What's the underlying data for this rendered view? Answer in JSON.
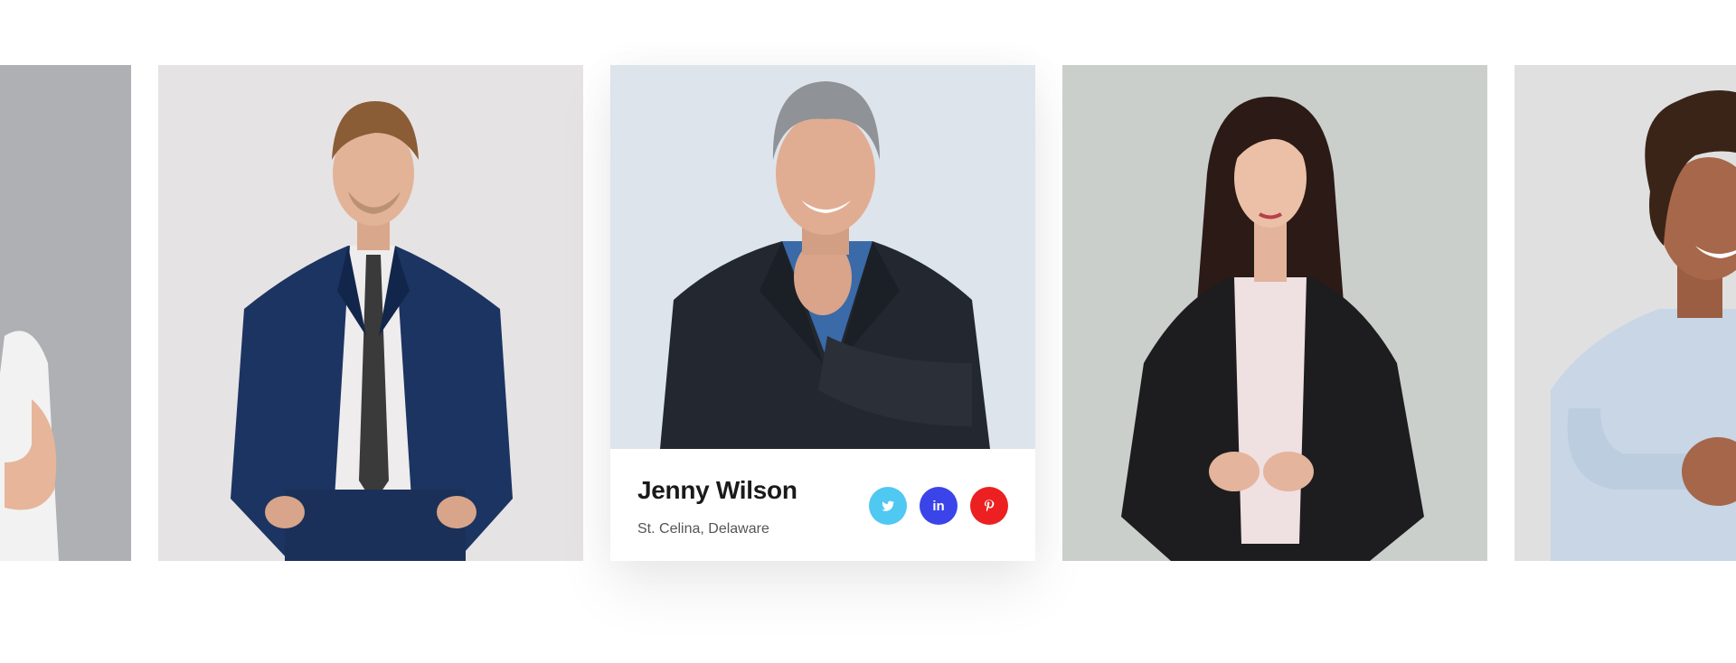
{
  "team": {
    "featured": {
      "name": "Jenny Wilson",
      "location": "St. Celina, Delaware"
    },
    "socials": [
      {
        "icon": "twitter-icon",
        "label": "twitter",
        "color": "#4fc8f2"
      },
      {
        "icon": "linkedin-icon",
        "label": "in",
        "color": "#3b44e8"
      },
      {
        "icon": "pinterest-icon",
        "label": "p",
        "color": "#ec2020"
      }
    ],
    "members": [
      {
        "photo": "man-white-tshirt-photo"
      },
      {
        "photo": "man-navy-suit-photo"
      },
      {
        "photo": "man-gray-hair-suit-photo"
      },
      {
        "photo": "woman-black-blazer-photo"
      },
      {
        "photo": "man-curly-hair-shirt-photo"
      }
    ]
  }
}
